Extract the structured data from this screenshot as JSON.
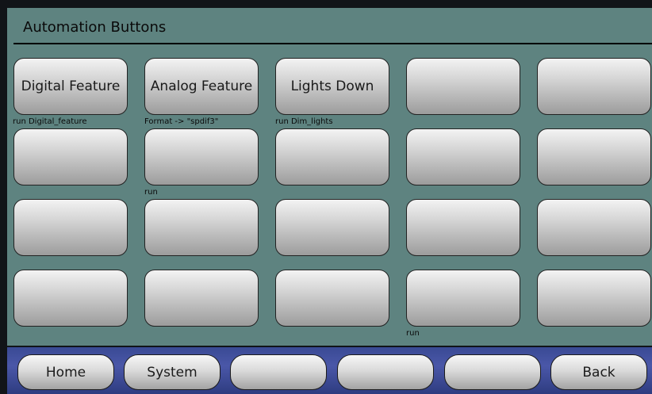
{
  "header": {
    "title": "Automation Buttons"
  },
  "grid": {
    "buttons": [
      [
        "Digital Feature",
        "Analog Feature",
        "Lights Down",
        "",
        ""
      ],
      [
        "",
        "",
        "",
        "",
        ""
      ],
      [
        "",
        "",
        "",
        "",
        ""
      ],
      [
        "",
        "",
        "",
        "",
        ""
      ]
    ],
    "commands": {
      "r0c0": "run Digital_feature",
      "r0c1": "Format -> \"spdif3\"",
      "r0c2": "run Dim_lights",
      "r1c1": "run",
      "r3c3": "run"
    }
  },
  "nav": {
    "buttons": [
      "Home",
      "System",
      "",
      "",
      "",
      "Back"
    ]
  },
  "colors": {
    "panel": "#5e8380",
    "navbar": "#3a4a94",
    "background": "#111418"
  }
}
